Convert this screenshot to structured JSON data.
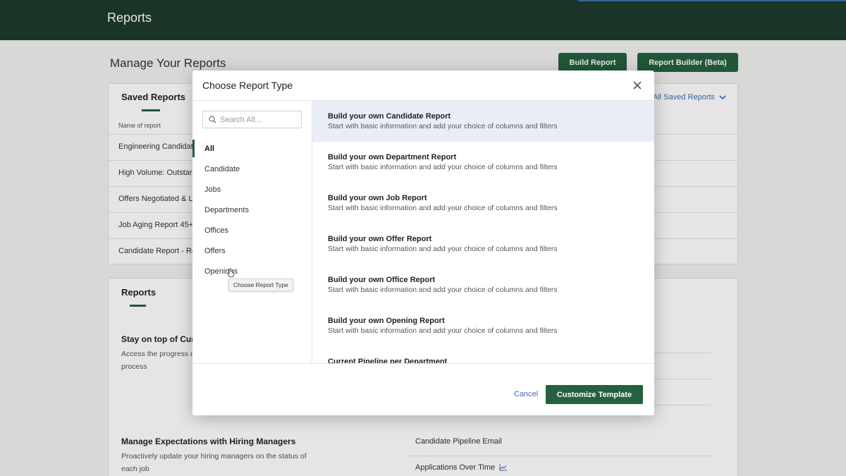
{
  "app": {
    "title": "Reports"
  },
  "page": {
    "heading": "Manage Your Reports",
    "build_report": "Build Report",
    "report_builder_beta": "Report Builder (Beta)"
  },
  "saved_reports": {
    "tab": "Saved Reports",
    "filter": "All Saved Reports",
    "column_header": "Name of report",
    "rows": [
      "Engineering Candidat",
      "High Volume: Outstar",
      "Offers Negotiated & L",
      "Job Aging Report 45+",
      "Candidate Report - Re"
    ]
  },
  "reports": {
    "tab": "Reports",
    "section1": {
      "title": "Stay on top of Cur",
      "desc": "Access the progress c process"
    },
    "section2": {
      "title": "Manage Expectations with Hiring Managers",
      "desc": "Proactively update your hiring managers on the status of each job"
    },
    "links": [
      "Candidate Pipeline Email",
      "Applications Over Time"
    ]
  },
  "modal": {
    "title": "Choose Report Type",
    "search_placeholder": "Search All...",
    "categories": [
      "All",
      "Candidate",
      "Jobs",
      "Departments",
      "Offices",
      "Offers",
      "Openings"
    ],
    "active_category": "All",
    "tooltip": "Choose Report Type",
    "options": [
      {
        "title": "Build your own Candidate Report",
        "desc": "Start with basic information and add your choice of columns and filters"
      },
      {
        "title": "Build your own Department Report",
        "desc": "Start with basic information and add your choice of columns and filters"
      },
      {
        "title": "Build your own Job Report",
        "desc": "Start with basic information and add your choice of columns and filters"
      },
      {
        "title": "Build your own Offer Report",
        "desc": "Start with basic information and add your choice of columns and filters"
      },
      {
        "title": "Build your own Office Report",
        "desc": "Start with basic information and add your choice of columns and filters"
      },
      {
        "title": "Build your own Opening Report",
        "desc": "Start with basic information and add your choice of columns and filters"
      },
      {
        "title": "Current Pipeline per Department",
        "desc": ""
      }
    ],
    "cancel": "Cancel",
    "primary": "Customize Template"
  },
  "colors": {
    "topbar": "#1d3a2c",
    "brand_green": "#24613f",
    "link_blue": "#3b6fb5",
    "selected_row": "#e9eef6"
  }
}
